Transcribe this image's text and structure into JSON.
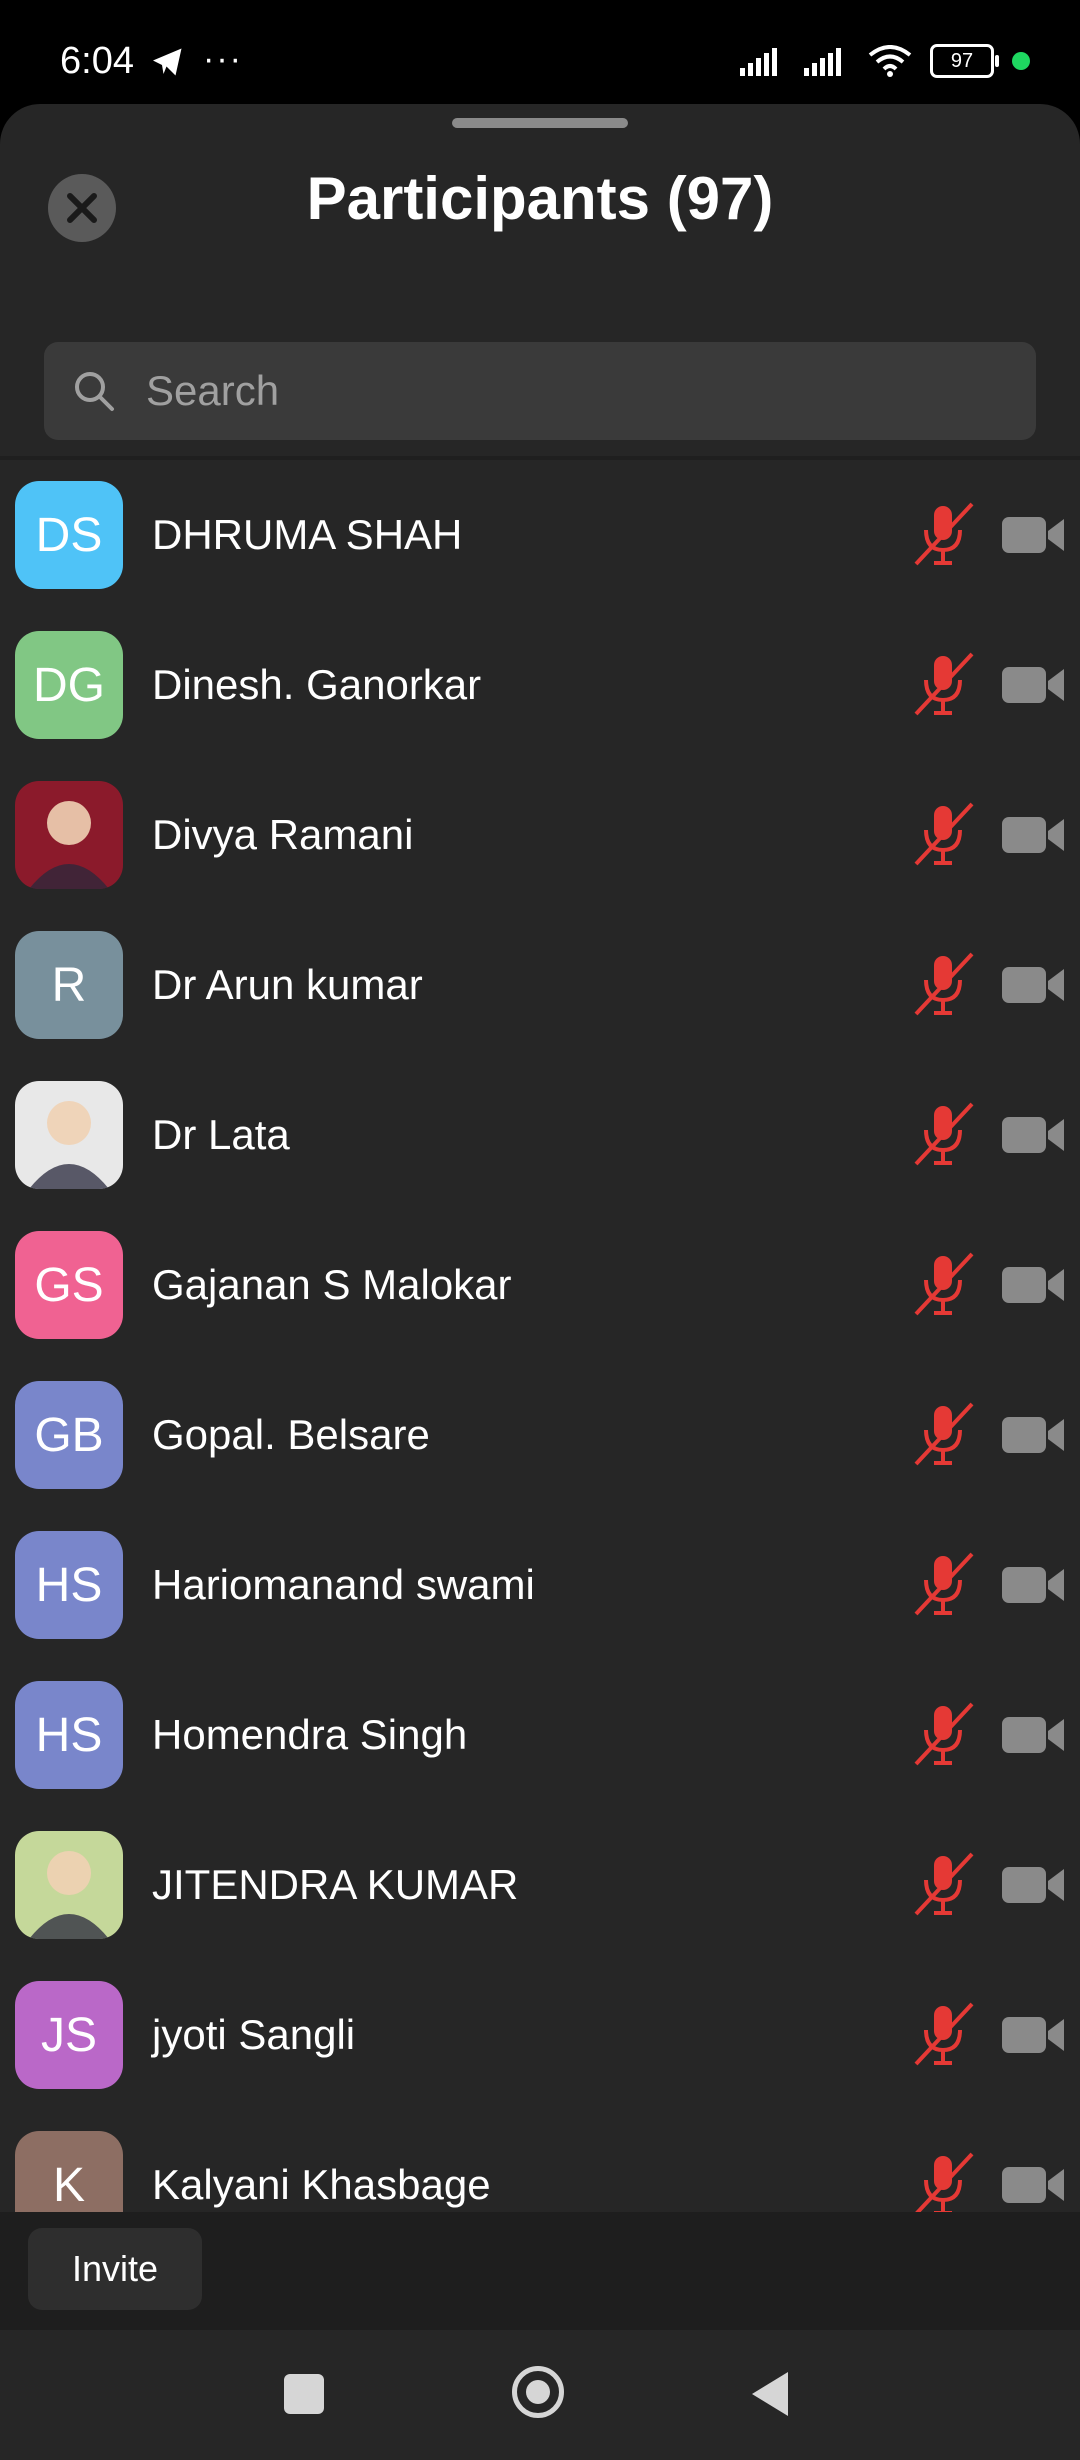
{
  "status_bar": {
    "time": "6:04",
    "dots": "···",
    "battery": "97"
  },
  "header": {
    "title": "Participants (97)"
  },
  "search": {
    "placeholder": "Search"
  },
  "participants": [
    {
      "initials": "DS",
      "name": "DHRUMA SHAH",
      "avatar_color": "#4fc3f7",
      "photo": false
    },
    {
      "initials": "DG",
      "name": "Dinesh. Ganorkar",
      "avatar_color": "#81c784",
      "photo": false
    },
    {
      "initials": "",
      "name": "Divya Ramani",
      "avatar_color": "#8b1a2b",
      "photo": true
    },
    {
      "initials": "R",
      "name": "Dr Arun kumar",
      "avatar_color": "#78909c",
      "photo": false
    },
    {
      "initials": "",
      "name": "Dr Lata",
      "avatar_color": "#e8e8e8",
      "photo": true
    },
    {
      "initials": "GS",
      "name": "Gajanan S Malokar",
      "avatar_color": "#f06292",
      "photo": false
    },
    {
      "initials": "GB",
      "name": "Gopal. Belsare",
      "avatar_color": "#7986cb",
      "photo": false
    },
    {
      "initials": "HS",
      "name": "Hariomanand swami",
      "avatar_color": "#7986cb",
      "photo": false
    },
    {
      "initials": "HS",
      "name": "Homendra Singh",
      "avatar_color": "#7986cb",
      "photo": false
    },
    {
      "initials": "",
      "name": "JITENDRA KUMAR",
      "avatar_color": "#c5d89a",
      "photo": true
    },
    {
      "initials": "JS",
      "name": "jyoti Sangli",
      "avatar_color": "#ba68c8",
      "photo": false
    },
    {
      "initials": "K",
      "name": "Kalyani Khasbage",
      "avatar_color": "#8d6e63",
      "photo": false
    }
  ],
  "footer": {
    "invite_label": "Invite"
  },
  "colors": {
    "mic_muted": "#e53935",
    "camera_off": "#8a8a8a"
  }
}
